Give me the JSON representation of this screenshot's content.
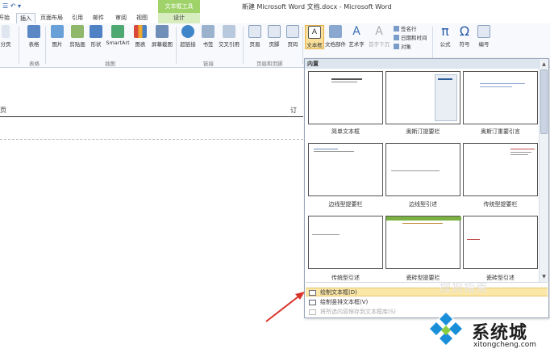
{
  "window": {
    "title": "新建 Microsoft Word 文档.docx - Microsoft Word",
    "context_tab_header": "文本框工具"
  },
  "tabs": [
    {
      "label": "开始",
      "key": "home"
    },
    {
      "label": "插入",
      "key": "insert"
    },
    {
      "label": "页面布局",
      "key": "layout"
    },
    {
      "label": "引用",
      "key": "references"
    },
    {
      "label": "邮件",
      "key": "mailings"
    },
    {
      "label": "审阅",
      "key": "review"
    },
    {
      "label": "视图",
      "key": "view"
    },
    {
      "label": "设计",
      "key": "design"
    }
  ],
  "ribbon": {
    "partial_left": "分页",
    "table": "表格",
    "picture": "图片",
    "clipart": "剪贴画",
    "shapes": "形状",
    "smartart": "SmartArt",
    "chart": "图表",
    "screenshot": "屏幕截图",
    "hyperlink": "超链接",
    "bookmark": "书签",
    "crossref": "交叉引用",
    "header": "页眉",
    "footer": "页脚",
    "pagenum": "页码",
    "textbox": "文本框",
    "quickparts": "文档部件",
    "wordart": "艺术字",
    "dropcap": "首字下沉",
    "signature": "签名行",
    "datetime": "日期和时间",
    "object": "对象",
    "equation": "公式",
    "symbol": "符号",
    "number": "编号",
    "group_tables": "表格",
    "group_illustrations": "插图",
    "group_links": "链接",
    "group_header": "页眉和页脚"
  },
  "document": {
    "header_left": "页",
    "header_right": "订"
  },
  "gallery": {
    "header": "内置",
    "items": [
      {
        "label": "简单文本框"
      },
      {
        "label": "奥斯汀提要栏"
      },
      {
        "label": "奥斯汀重要引言"
      },
      {
        "label": "边线型提要栏"
      },
      {
        "label": "边线型引述"
      },
      {
        "label": "传统型提要栏"
      },
      {
        "label": "传统型引述"
      },
      {
        "label": "瓷砖型提要栏"
      },
      {
        "label": "瓷砖型引述"
      }
    ],
    "menu": {
      "draw": "绘制文本框(D)",
      "draw_vertical": "绘制竖排文本框(V)",
      "save_selection": "将所选内容保存到文本框库(S)"
    }
  },
  "watermark": {
    "sogou": "搜狗指南",
    "site_name": "系统城",
    "site_url": "xitongcheng.com"
  },
  "colors": {
    "ribbon_bg": "#f7f9fc",
    "highlight": "#fbe7a8",
    "context_green": "#9fd36a",
    "arrow_red": "#d9342b",
    "logo_blue": "#1a8fd9"
  }
}
